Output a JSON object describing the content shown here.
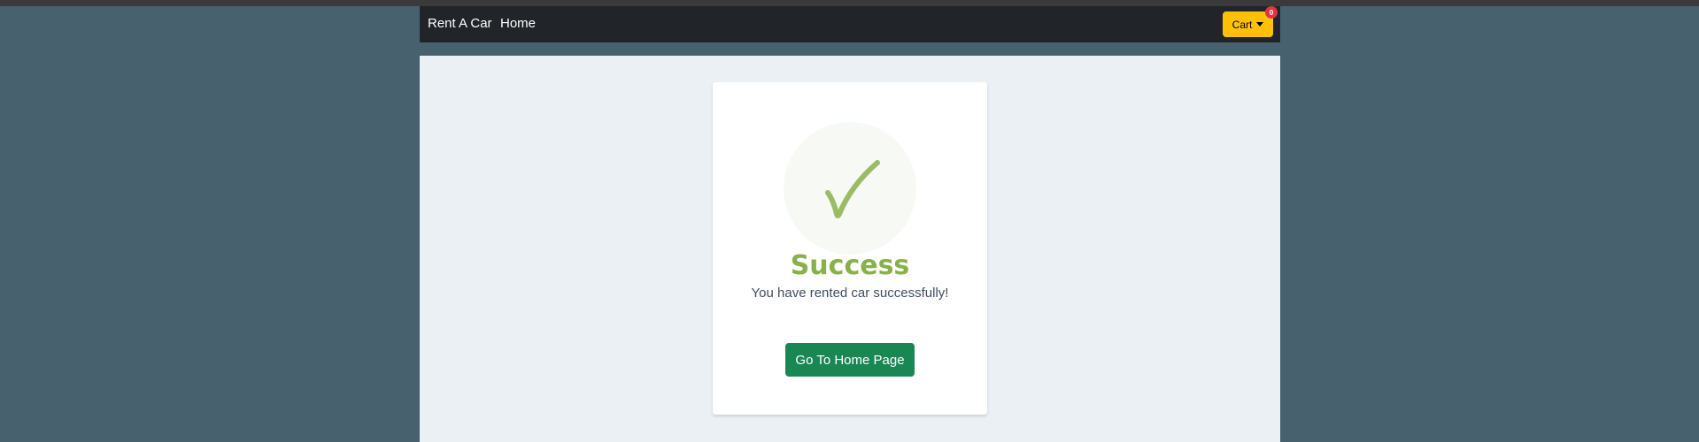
{
  "navbar": {
    "brand": "Rent A Car",
    "home_link": "Home",
    "cart_label": "Cart",
    "cart_count": "0"
  },
  "success_card": {
    "icon": "checkmark-icon",
    "title": "Success",
    "message": "You have rented car successfully!",
    "button_label": "Go To Home Page"
  },
  "colors": {
    "page_background": "#48616e",
    "navbar_background": "#212529",
    "cart_button": "#ffc107",
    "badge": "#dc3545",
    "content_background": "#ebf0f4",
    "success_green": "#88b04b",
    "home_button": "#198754"
  }
}
